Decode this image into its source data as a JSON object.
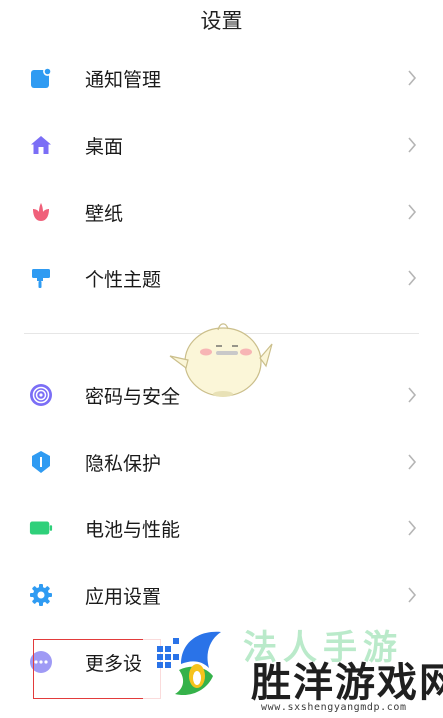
{
  "header": {
    "title": "设置"
  },
  "menu": {
    "items": [
      {
        "label": "通知管理",
        "icon": "notification-icon"
      },
      {
        "label": "桌面",
        "icon": "home-icon"
      },
      {
        "label": "壁纸",
        "icon": "wallpaper-flower-icon"
      },
      {
        "label": "个性主题",
        "icon": "theme-brush-icon"
      },
      {
        "label": "密码与安全",
        "icon": "fingerprint-icon"
      },
      {
        "label": "隐私保护",
        "icon": "privacy-shield-icon"
      },
      {
        "label": "电池与性能",
        "icon": "battery-icon"
      },
      {
        "label": "应用设置",
        "icon": "gear-icon"
      },
      {
        "label": "更多设",
        "icon": "more-icon"
      }
    ]
  },
  "watermark": {
    "top_text": "法人手游",
    "brand": "胜洋游戏网",
    "url": "www.sxshengyangmdp.com"
  },
  "colors": {
    "blue": "#2f9bf2",
    "purple": "#7b6ef6",
    "pink": "#f0607a",
    "green": "#2fd07a",
    "divider": "#e6e6e6",
    "chevron": "#b5b5b5",
    "highlight": "#e23b3b"
  }
}
